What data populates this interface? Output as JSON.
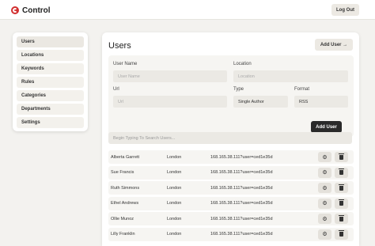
{
  "app": {
    "name": "Control",
    "logout_label": "Log Out"
  },
  "sidebar": {
    "items": [
      {
        "label": "Users"
      },
      {
        "label": "Locations"
      },
      {
        "label": "Keywords"
      },
      {
        "label": "Rules"
      },
      {
        "label": "Categories"
      },
      {
        "label": "Departments"
      },
      {
        "label": "Settings"
      }
    ]
  },
  "main": {
    "title": "Users",
    "add_user_top_label": "Add User →",
    "filters": {
      "user_name_label": "User Name",
      "user_name_placeholder": "User Name",
      "location_label": "Location",
      "location_placeholder": "Location",
      "url_label": "Url",
      "url_placeholder": "Url",
      "type_label": "Type",
      "type_value": "Single Author",
      "format_label": "Format",
      "format_value": "RSS",
      "add_user_label": "Add User"
    },
    "search_placeholder": "Begin Typing To Search Users...",
    "rows": [
      {
        "name": "Alberta Garrett",
        "location": "London",
        "url": "168.165.38.111?user=ced1e35d"
      },
      {
        "name": "Sue Francis",
        "location": "London",
        "url": "168.165.38.111?user=ced1e35d"
      },
      {
        "name": "Ruth Simmons",
        "location": "London",
        "url": "168.165.38.111?user=ced1e35d"
      },
      {
        "name": "Ethel Andrews",
        "location": "London",
        "url": "168.165.38.111?user=ced1e35d"
      },
      {
        "name": "Ollie Munoz",
        "location": "London",
        "url": "168.165.38.111?user=ced1e35d"
      },
      {
        "name": "Lilly Franklin",
        "location": "London",
        "url": "168.165.38.111?user=ced1e35d"
      }
    ]
  },
  "colors": {
    "brand": "#d22f2f",
    "primary_button": "#2a2a2a",
    "background": "#f3f2ef"
  }
}
